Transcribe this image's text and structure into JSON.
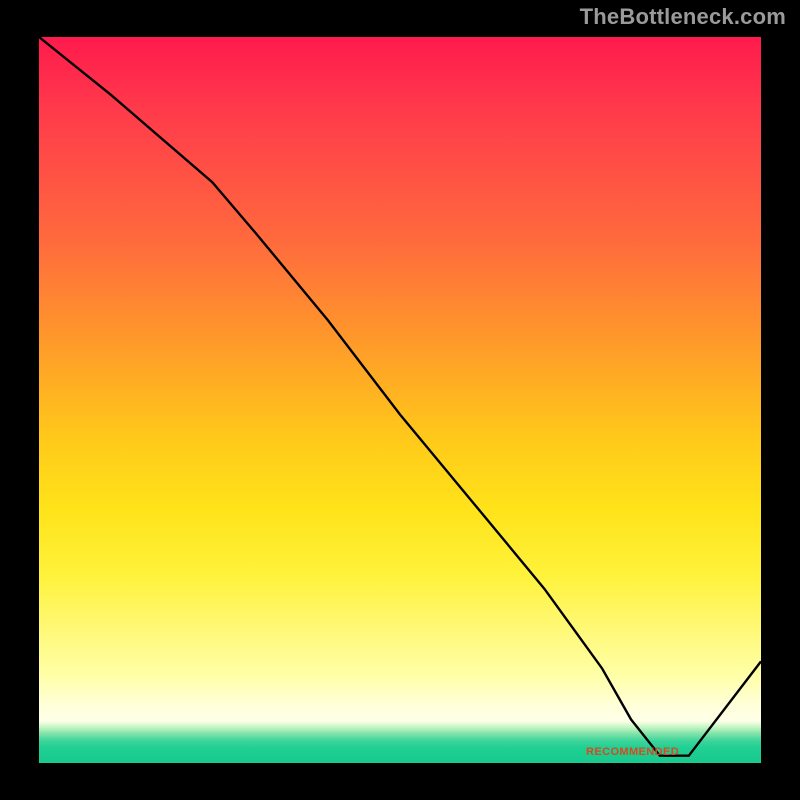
{
  "watermark": "TheBottleneck.com",
  "chart_data": {
    "type": "line",
    "title": "",
    "xlabel": "",
    "ylabel": "",
    "xlim": [
      0,
      100
    ],
    "ylim": [
      0,
      100
    ],
    "series": [
      {
        "name": "curve",
        "x": [
          0,
          10,
          24,
          30,
          40,
          50,
          60,
          70,
          78,
          82,
          86,
          90,
          100
        ],
        "y": [
          100,
          92,
          80,
          73,
          61,
          48,
          36,
          24,
          13,
          6,
          1,
          1,
          14
        ]
      }
    ],
    "annotations": [
      {
        "text": "RECOMMENDED",
        "x": 82,
        "y": 1
      }
    ],
    "gradient_stops": [
      {
        "pos": 0.0,
        "color": "#ff1a4d"
      },
      {
        "pos": 0.28,
        "color": "#ff6a3d"
      },
      {
        "pos": 0.55,
        "color": "#ffc81a"
      },
      {
        "pos": 0.74,
        "color": "#fff23a"
      },
      {
        "pos": 0.92,
        "color": "#ffffd8"
      },
      {
        "pos": 0.96,
        "color": "#7de2a8"
      },
      {
        "pos": 1.0,
        "color": "#18ca8d"
      }
    ]
  }
}
